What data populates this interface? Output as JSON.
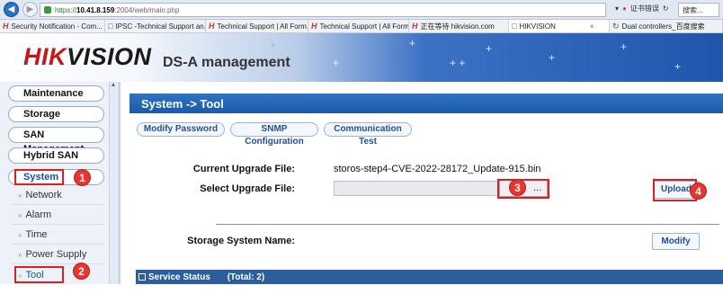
{
  "browser": {
    "url_scheme": "https://",
    "url_host": "10.41.8.159",
    "url_path": ":2004/web/main.php",
    "cert_warning": "证书错误",
    "search_placeholder": "搜索...",
    "tabs": [
      {
        "label": "Security Notification - Com...",
        "icon": "hik",
        "active": false
      },
      {
        "label": "IPSC -Technical Support an...",
        "icon": "doc",
        "active": false
      },
      {
        "label": "Technical Support | All Form...",
        "icon": "hik",
        "active": false
      },
      {
        "label": "Technical Support | All Form...",
        "icon": "hik",
        "active": false
      },
      {
        "label": "正在等待 hikvision.com",
        "icon": "hik",
        "active": false
      },
      {
        "label": "HIKVISION",
        "icon": "doc",
        "active": true
      },
      {
        "label": "Dual controllers_百度搜索",
        "icon": "doc",
        "active": false
      }
    ]
  },
  "banner": {
    "logo_part1": "HIK",
    "logo_part2": "VISION",
    "product": "DS-A management"
  },
  "sidebar": {
    "items": [
      {
        "label": "Maintenance"
      },
      {
        "label": "Storage"
      },
      {
        "label": "SAN Management"
      },
      {
        "label": "Hybrid SAN"
      },
      {
        "label": "System"
      }
    ],
    "sub_items": [
      {
        "label": "Network"
      },
      {
        "label": "Alarm"
      },
      {
        "label": "Time"
      },
      {
        "label": "Power Supply"
      },
      {
        "label": "Tool"
      }
    ]
  },
  "main": {
    "title": "System -> Tool",
    "tabs": [
      {
        "label": "Modify Password"
      },
      {
        "label": "SNMP Configuration"
      },
      {
        "label": "Communication Test"
      }
    ],
    "current_upgrade_label": "Current Upgrade File:",
    "current_upgrade_value": "storos-step4-CVE-2022-28172_Update-915.bin",
    "select_upgrade_label": "Select Upgrade File:",
    "browse_label": "...",
    "upload_label": "Upload",
    "storage_name_label": "Storage System Name:",
    "modify_label": "Modify",
    "service_status_label": "Service Status",
    "service_total": "(Total: 2)"
  },
  "annotations": {
    "badges": [
      "1",
      "2",
      "3",
      "4"
    ],
    "color": "#e01e1e"
  }
}
